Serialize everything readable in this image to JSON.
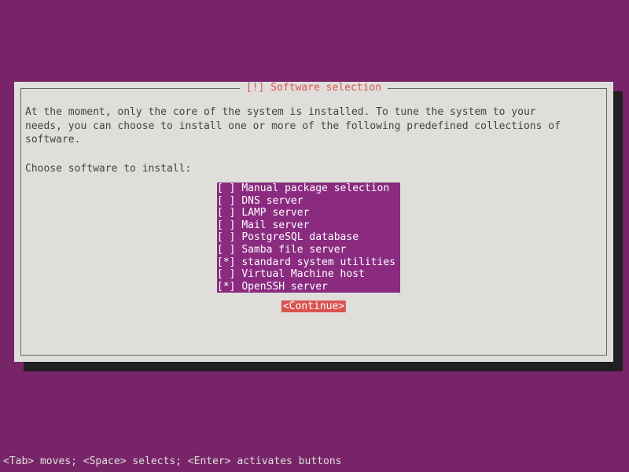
{
  "dialog": {
    "title": "[!] Software selection",
    "description_line1": "At the moment, only the core of the system is installed. To tune the system to your",
    "description_line2": "needs, you can choose to install one or more of the following predefined collections of",
    "description_line3": "software.",
    "prompt": "Choose software to install:",
    "continue_label": "<Continue>"
  },
  "items": [
    {
      "checked": false,
      "label": "Manual package selection"
    },
    {
      "checked": false,
      "label": "DNS server"
    },
    {
      "checked": false,
      "label": "LAMP server"
    },
    {
      "checked": false,
      "label": "Mail server"
    },
    {
      "checked": false,
      "label": "PostgreSQL database"
    },
    {
      "checked": false,
      "label": "Samba file server"
    },
    {
      "checked": true,
      "label": "standard system utilities"
    },
    {
      "checked": false,
      "label": "Virtual Machine host"
    },
    {
      "checked": true,
      "label": "OpenSSH server"
    }
  ],
  "help_bar": "<Tab> moves; <Space> selects; <Enter> activates buttons"
}
